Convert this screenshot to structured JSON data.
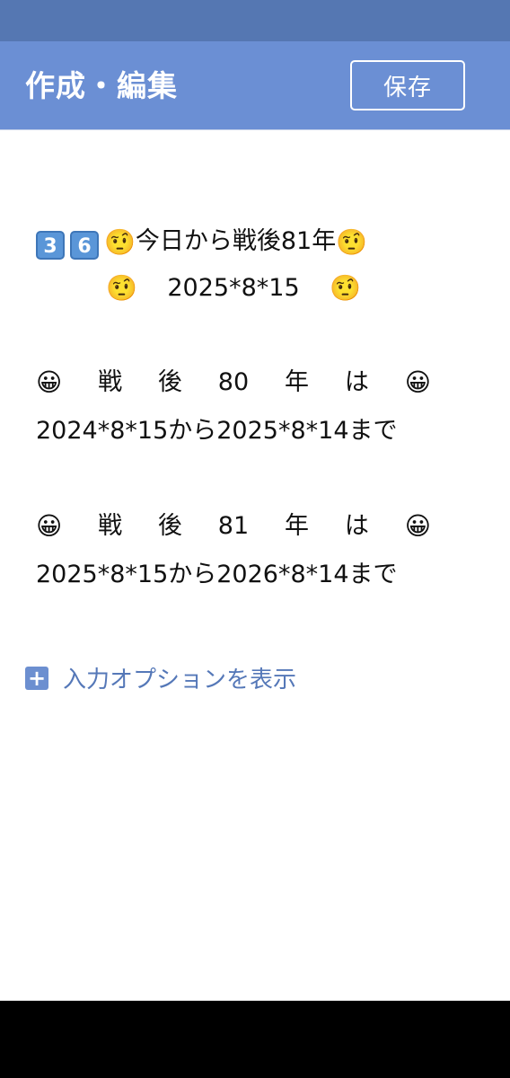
{
  "header": {
    "title": "作成・編集",
    "save_label": "保存"
  },
  "editor": {
    "line1": {
      "keycaps": [
        "3",
        "6"
      ],
      "emoji": "🤨",
      "text": "今日から戦後81年"
    },
    "line2": {
      "emoji": "🤨",
      "text": "2025*8*15"
    },
    "block1": {
      "emoji": "😀",
      "words": [
        "戦",
        "後",
        "80",
        "年",
        "は"
      ],
      "range": "2024*8*15から2025*8*14まで"
    },
    "block2": {
      "emoji": "😀",
      "words": [
        "戦",
        "後",
        "81",
        "年",
        "は"
      ],
      "range": "2025*8*15から2026*8*14まで"
    }
  },
  "options": {
    "icon": "plus-icon",
    "label": "入力オプションを表示"
  },
  "colors": {
    "status_bar": "#5577b2",
    "app_bar": "#6b8fd4",
    "link": "#5578b8",
    "nav_bar": "#000000"
  }
}
